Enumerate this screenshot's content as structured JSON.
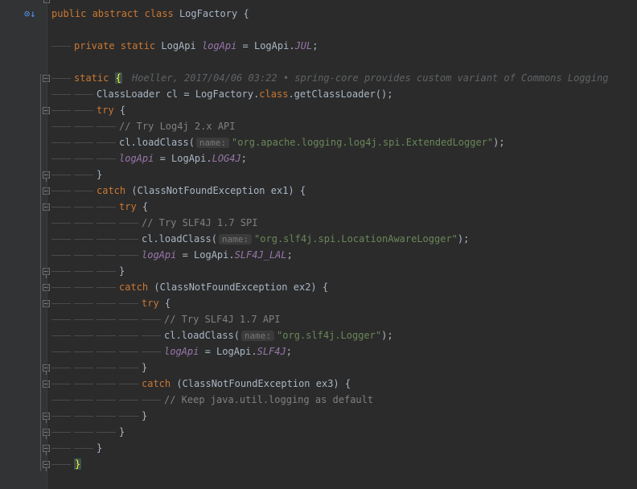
{
  "editor": {
    "language": "java",
    "lines": [
      {
        "id": "l1",
        "tokens": [
          [
            "kw",
            "public abstract class "
          ],
          [
            "cls",
            "LogFactory "
          ],
          [
            "punc",
            "{"
          ]
        ]
      },
      {
        "id": "l2",
        "tokens": [
          [
            "kw",
            "private static "
          ],
          [
            "cls",
            "LogApi "
          ],
          [
            "field",
            "logApi"
          ],
          [
            "punc",
            " = LogApi."
          ],
          [
            "field",
            "JUL"
          ],
          [
            "punc",
            ";"
          ]
        ]
      },
      {
        "id": "l3",
        "tokens": [
          [
            "kw",
            "static "
          ]
        ],
        "brace": "{",
        "blame": "Hoeller, 2017/04/06 03:22 • spring-core provides custom variant of Commons Logging"
      },
      {
        "id": "l4",
        "tokens": [
          [
            "cls",
            "ClassLoader cl = LogFactory."
          ],
          [
            "kw",
            "class"
          ],
          [
            "punc",
            ".getClassLoader();"
          ]
        ]
      },
      {
        "id": "l5",
        "tokens": [
          [
            "kw",
            "try "
          ],
          [
            "punc",
            "{"
          ]
        ]
      },
      {
        "id": "l6",
        "tokens": [
          [
            "cmt",
            "// Try Log4j 2.x API"
          ]
        ]
      },
      {
        "id": "l7",
        "tokens": [
          [
            "cls",
            "cl.loadClass("
          ],
          [
            "hint",
            "name:"
          ],
          [
            "str",
            "\"org.apache.logging.log4j.spi.ExtendedLogger\""
          ],
          [
            "punc",
            ");"
          ]
        ]
      },
      {
        "id": "l8",
        "tokens": [
          [
            "field",
            "logApi"
          ],
          [
            "punc",
            " = LogApi."
          ],
          [
            "field",
            "LOG4J"
          ],
          [
            "punc",
            ";"
          ]
        ]
      },
      {
        "id": "l9",
        "tokens": [
          [
            "punc",
            "}"
          ]
        ]
      },
      {
        "id": "l10",
        "tokens": [
          [
            "kw",
            "catch "
          ],
          [
            "punc",
            "(ClassNotFoundException ex1) {"
          ]
        ]
      },
      {
        "id": "l11",
        "tokens": [
          [
            "kw",
            "try "
          ],
          [
            "punc",
            "{"
          ]
        ]
      },
      {
        "id": "l12",
        "tokens": [
          [
            "cmt",
            "// Try SLF4J 1.7 SPI"
          ]
        ]
      },
      {
        "id": "l13",
        "tokens": [
          [
            "cls",
            "cl.loadClass("
          ],
          [
            "hint",
            "name:"
          ],
          [
            "str",
            "\"org.slf4j.spi.LocationAwareLogger\""
          ],
          [
            "punc",
            ");"
          ]
        ]
      },
      {
        "id": "l14",
        "tokens": [
          [
            "field",
            "logApi"
          ],
          [
            "punc",
            " = LogApi."
          ],
          [
            "field",
            "SLF4J_LAL"
          ],
          [
            "punc",
            ";"
          ]
        ]
      },
      {
        "id": "l15",
        "tokens": [
          [
            "punc",
            "}"
          ]
        ]
      },
      {
        "id": "l16",
        "tokens": [
          [
            "kw",
            "catch "
          ],
          [
            "punc",
            "(ClassNotFoundException ex2) {"
          ]
        ]
      },
      {
        "id": "l17",
        "tokens": [
          [
            "kw",
            "try "
          ],
          [
            "punc",
            "{"
          ]
        ]
      },
      {
        "id": "l18",
        "tokens": [
          [
            "cmt",
            "// Try SLF4J 1.7 API"
          ]
        ]
      },
      {
        "id": "l19",
        "tokens": [
          [
            "cls",
            "cl.loadClass("
          ],
          [
            "hint",
            "name:"
          ],
          [
            "str",
            "\"org.slf4j.Logger\""
          ],
          [
            "punc",
            ");"
          ]
        ]
      },
      {
        "id": "l20",
        "tokens": [
          [
            "field",
            "logApi"
          ],
          [
            "punc",
            " = LogApi."
          ],
          [
            "field",
            "SLF4J"
          ],
          [
            "punc",
            ";"
          ]
        ]
      },
      {
        "id": "l21",
        "tokens": [
          [
            "punc",
            "}"
          ]
        ]
      },
      {
        "id": "l22",
        "tokens": [
          [
            "kw",
            "catch "
          ],
          [
            "punc",
            "(ClassNotFoundException ex3) {"
          ]
        ]
      },
      {
        "id": "l23",
        "tokens": [
          [
            "cmt",
            "// Keep java.util.logging as default"
          ]
        ]
      },
      {
        "id": "l24",
        "tokens": [
          [
            "punc",
            "}"
          ]
        ]
      },
      {
        "id": "l25",
        "tokens": [
          [
            "punc",
            "}"
          ]
        ]
      },
      {
        "id": "l26",
        "tokens": [
          [
            "punc",
            "}"
          ]
        ]
      },
      {
        "id": "l27",
        "tokens": [],
        "brace": "}"
      }
    ]
  },
  "colors": {
    "background": "#2b2b2b",
    "gutter": "#313335",
    "keyword": "#cc7832",
    "field": "#9876aa",
    "string": "#6a8759",
    "comment": "#808080",
    "text": "#a9b7c6"
  },
  "icons": {
    "gutter_marker": "implemented-method-icon"
  }
}
